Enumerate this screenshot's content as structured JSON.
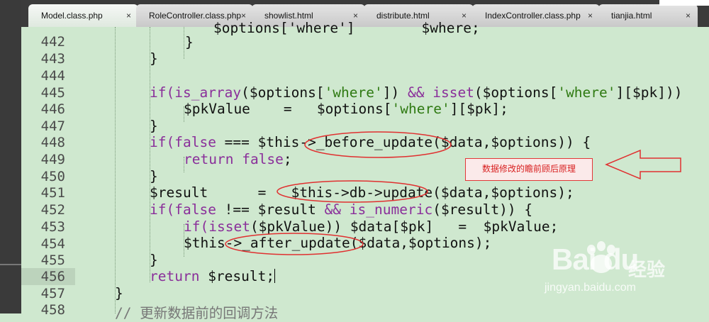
{
  "tabs": [
    {
      "label": "Model.class.php",
      "active": true
    },
    {
      "label": "RoleController.class.php",
      "active": false
    },
    {
      "label": "showlist.html",
      "active": false
    },
    {
      "label": "distribute.html",
      "active": false
    },
    {
      "label": "IndexController.class.php",
      "active": false
    },
    {
      "label": "tianjia.html",
      "active": false
    }
  ],
  "tab_close_glyph": "×",
  "line_numbers": [
    "442",
    "443",
    "444",
    "445",
    "446",
    "447",
    "448",
    "449",
    "450",
    "451",
    "452",
    "453",
    "454",
    "455",
    "456",
    "457",
    "458"
  ],
  "code": {
    "l441": "$options['where']        $where;",
    "l442_brace": "}",
    "l443_brace": "}",
    "l445_if": "if(",
    "l445_is_array": "is_array",
    "l445_a": "($options[",
    "l445_where1": "'where'",
    "l445_b": "]) ",
    "l445_and": "&&",
    "l445_c": " ",
    "l445_isset": "isset",
    "l445_d": "($options[",
    "l445_where2": "'where'",
    "l445_e": "][$pk]))",
    "l446_a": "$pkValue    =   $options[",
    "l446_where": "'where'",
    "l446_b": "][$pk];",
    "l447_brace": "}",
    "l448_if": "if(",
    "l448_false": "false",
    "l448_rest": " === $this->_before_update($data,$options)) {",
    "l449_return": "return",
    "l449_sp": " ",
    "l449_false": "false",
    "l449_semi": ";",
    "l450_brace": "}",
    "l451": "$result      =   $this->db->update($data,$options);",
    "l452_if": "if(",
    "l452_false": "false",
    "l452_a": " !== $result ",
    "l452_and": "&&",
    "l452_b": " ",
    "l452_isnum": "is_numeric",
    "l452_c": "($result)) {",
    "l453_if": "if(",
    "l453_isset": "isset",
    "l453_rest": "($pkValue)) $data[$pk]   =  $pkValue;",
    "l454": "$this->_after_update($data,$options);",
    "l455_brace": "}",
    "l456_return": "return",
    "l456_rest": " $result;",
    "l457_brace": "}",
    "l458_comment": "// 更新数据前的回调方法"
  },
  "annotation": {
    "text": "数据修改的瞻前顾后原理",
    "color": "#e23838"
  },
  "watermark": {
    "title": "Bai   du",
    "cn": "经验",
    "url": "jingyan.baidu.com"
  }
}
